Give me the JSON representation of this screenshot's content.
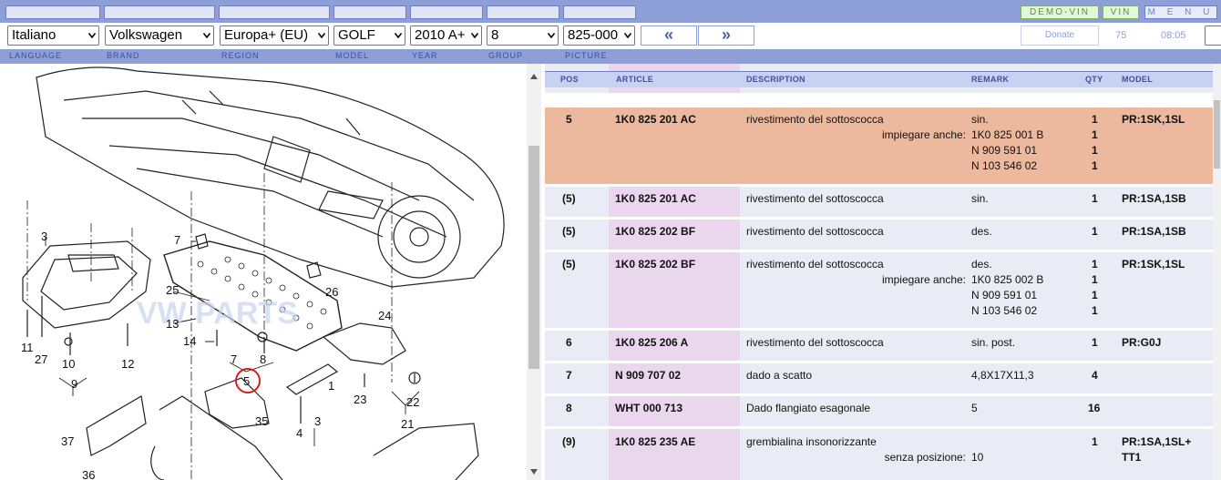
{
  "topbar": {
    "tabs": [
      "",
      "",
      "",
      "",
      "",
      "",
      "",
      ""
    ],
    "demo_vin": "DEMO-VIN",
    "vin": "VIN",
    "menu": "M E N U"
  },
  "selectors": {
    "language": "Italiano",
    "brand": "Volkswagen",
    "region": "Europa+ (EU)",
    "model": "GOLF",
    "year": "2010  A+",
    "group": "8",
    "picture": "825-000",
    "prev": "«",
    "next": "»",
    "donate": "Donate",
    "count": "75",
    "time": "08:05"
  },
  "labels": {
    "language": "LANGUAGE",
    "brand": "BRAND",
    "region": "REGION",
    "model": "MODEL",
    "year": "YEAR",
    "group": "GROUP",
    "picture": "PICTURE"
  },
  "diagram": {
    "callouts": [
      "3",
      "7",
      "25",
      "13",
      "14",
      "11",
      "27",
      "10",
      "9",
      "12",
      "7",
      "8",
      "5",
      "35",
      "26",
      "24",
      "1",
      "3",
      "4",
      "23",
      "22",
      "21",
      "37",
      "36"
    ]
  },
  "table": {
    "headers": {
      "pos": "POS",
      "article": "ARTICLE",
      "description": "DESCRIPTION",
      "remark": "REMARK",
      "qty": "QTY",
      "model": "MODEL"
    },
    "rows": [
      {
        "pos": "5",
        "article": "1K0 825 201 AC",
        "description": "rivestimento del sottoscocca",
        "remark": "sin.",
        "qty": "1",
        "model": "PR:1SK,1SL",
        "sub_label": "impiegare anche:",
        "sub_remarks": [
          "1K0 825 001 B",
          "N   909 591 01",
          "N   103 546 02"
        ],
        "sub_qty": [
          "1",
          "1",
          "1"
        ]
      },
      {
        "pos": "(5)",
        "article": "1K0 825 201 AC",
        "description": "rivestimento del sottoscocca",
        "remark": "sin.",
        "qty": "1",
        "model": "PR:1SA,1SB"
      },
      {
        "pos": "(5)",
        "article": "1K0 825 202 BF",
        "description": "rivestimento del sottoscocca",
        "remark": "des.",
        "qty": "1",
        "model": "PR:1SA,1SB"
      },
      {
        "pos": "(5)",
        "article": "1K0 825 202 BF",
        "description": "rivestimento del sottoscocca",
        "remark": "des.",
        "qty": "1",
        "model": "PR:1SK,1SL",
        "sub_label": "impiegare anche:",
        "sub_remarks": [
          "1K0 825 002 B",
          "N   909 591 01",
          "N   103 546 02"
        ],
        "sub_qty": [
          "1",
          "1",
          "1"
        ]
      },
      {
        "pos": "6",
        "article": "1K0 825 206 A",
        "description": "rivestimento del sottoscocca",
        "remark": "sin. post.",
        "qty": "1",
        "model": "PR:G0J"
      },
      {
        "pos": "7",
        "article": "N   909 707 02",
        "description": "dado a scatto",
        "remark": "4,8X17X11,3",
        "qty": "4",
        "model": ""
      },
      {
        "pos": "8",
        "article": "WHT 000 713",
        "description": "Dado flangiato esagonale",
        "remark": "5",
        "qty": "16",
        "model": ""
      },
      {
        "pos": "(9)",
        "article": "1K0 825 235 AE",
        "description": "grembialina insonorizzante",
        "remark": "",
        "qty": "1",
        "model": "PR:1SA,1SL+",
        "model2": "TT1",
        "sub_label": "senza posizione:",
        "sub_remarks": [
          "10"
        ]
      }
    ]
  },
  "colors": {
    "bar": "#8e9ed6",
    "selected_row": "#edb99e",
    "article_col": "#ead7ee",
    "row_bg": "#e9ecf5"
  }
}
